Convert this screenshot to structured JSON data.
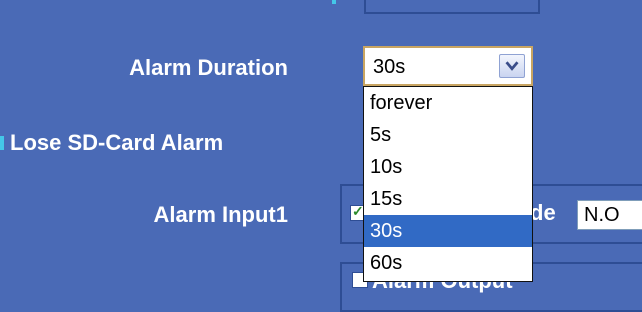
{
  "labels": {
    "alarm_duration": "Alarm Duration",
    "lose_sd_card_alarm": "Lose SD-Card Alarm",
    "alarm_input1": "Alarm Input1",
    "mode_label_fragment": "de",
    "alarm_output": "Alarm Output"
  },
  "alarm_duration_select": {
    "value": "30s",
    "options": [
      "forever",
      "5s",
      "10s",
      "15s",
      "30s",
      "60s"
    ],
    "selected_index": 4
  },
  "mode_field": {
    "value": "N.O"
  },
  "colors": {
    "background": "#4a6ab6",
    "selected_option": "#316ac5",
    "select_border": "#c9a562"
  }
}
